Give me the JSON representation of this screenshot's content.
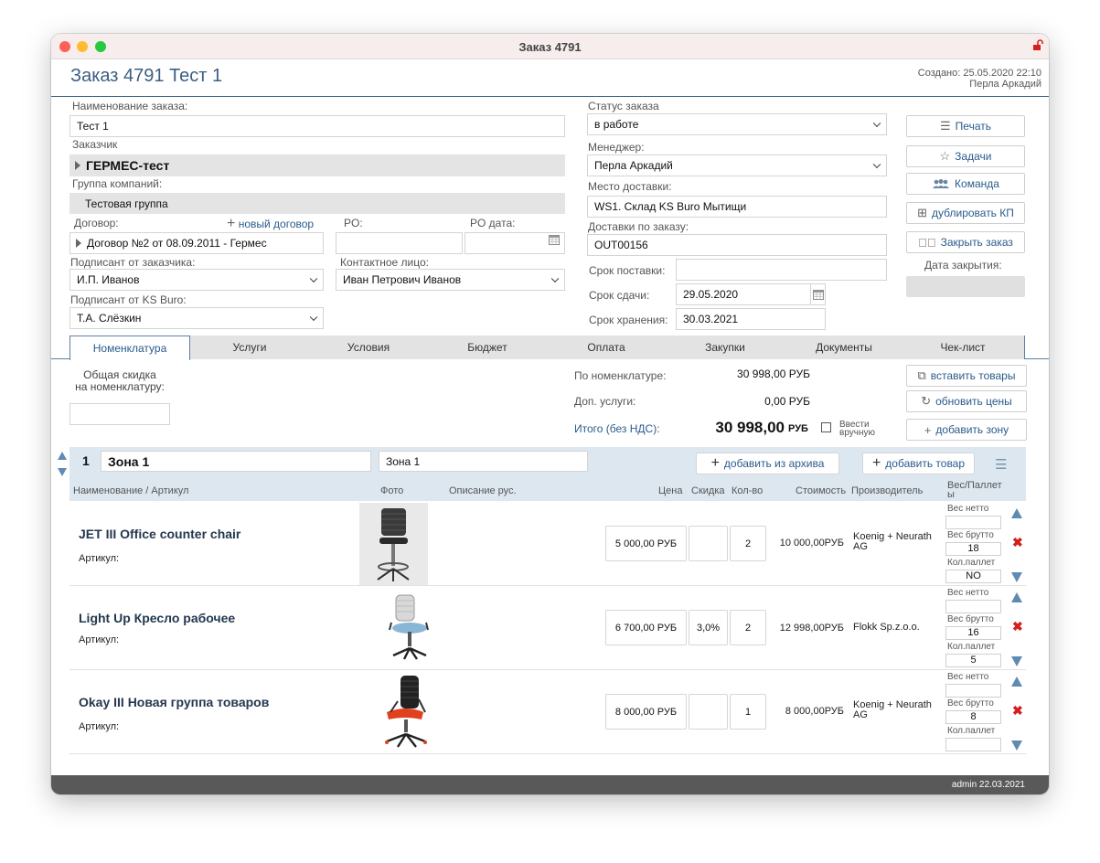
{
  "window": {
    "title": "Заказ 4791"
  },
  "header": {
    "title": "Заказ 4791 Тест 1",
    "created": "Создано: 25.05.2020 22:10",
    "author": "Перла Аркадий"
  },
  "form": {
    "order_name_label": "Наименование заказа:",
    "order_name_value": "Тест 1",
    "customer_label": "Заказчик",
    "customer_value": "ГЕРМЕС-тест",
    "group_label": "Группа компаний:",
    "group_value": "Тестовая группа",
    "contract_label": "Договор:",
    "new_contract_link": "новый договор",
    "contract_value": "Договор №2 от 08.09.2011 - Гермес",
    "po_label": "PO:",
    "po_value": "",
    "po_date_label": "PO дата:",
    "po_date_value": "",
    "signer_customer_label": "Подписант от заказчика:",
    "signer_customer_value": "И.П. Иванов",
    "contact_label": "Контактное лицо:",
    "contact_value": "Иван Петрович Иванов",
    "signer_ks_label": "Подписант от KS Buro:",
    "signer_ks_value": "Т.А. Слёзкин",
    "status_label": "Статус заказа",
    "status_value": "в работе",
    "manager_label": "Менеджер:",
    "manager_value": "Перла Аркадий",
    "delivery_place_label": "Место доставки:",
    "delivery_place_value": "WS1. Склад KS Buro Мытищи",
    "deliveries_label": "Доставки по заказу:",
    "deliveries_value": "OUT00156",
    "delivery_term_label": "Срок поставки:",
    "delivery_term_value": "",
    "handover_label": "Срок сдачи:",
    "handover_value": "29.05.2020",
    "storage_label": "Срок хранения:",
    "storage_value": "30.03.2021"
  },
  "actions": {
    "print": "Печать",
    "tasks": "Задачи",
    "team": "Команда",
    "duplicate": "дублировать КП",
    "close_order": "Закрыть заказ",
    "close_date_label": "Дата закрытия:"
  },
  "tabs": [
    "Номенклатура",
    "Услуги",
    "Условия",
    "Бюджет",
    "Оплата",
    "Закупки",
    "Документы",
    "Чек-лист"
  ],
  "summary": {
    "discount_label_1": "Общая скидка",
    "discount_label_2": "на номенклатуру:",
    "by_nomenclature_label": "По номенклатуре:",
    "by_nomenclature_value": "30 998,00 РУБ",
    "extra_services_label": "Доп. услуги:",
    "extra_services_value": "0,00 РУБ",
    "total_label": "Итого (без НДС):",
    "total_value": "30 998,00",
    "total_currency": "РУБ",
    "manual_label_1": "Ввести",
    "manual_label_2": "вручную",
    "insert_goods": "вставить товары",
    "update_prices": "обновить цены",
    "add_zone": "добавить зону"
  },
  "zone": {
    "number": "1",
    "name": "Зона 1",
    "name2": "Зона 1",
    "add_from_archive": "добавить из архива",
    "add_product": "добавить товар"
  },
  "columns": {
    "name": "Наименование / Артикул",
    "photo": "Фото",
    "desc": "Описание рус.",
    "price": "Цена",
    "discount": "Скидка",
    "qty": "Кол-во",
    "cost": "Стоимость",
    "maker": "Производитель",
    "weight_1": "Вес/Паллет",
    "weight_2": "ы"
  },
  "weight_labels": {
    "net": "Вес нетто",
    "gross": "Вес брутто",
    "pallets": "Кол.паллет"
  },
  "products": [
    {
      "name": "JET III  Office counter chair",
      "article": "Артикул:",
      "price": "5 000,00 РУБ",
      "discount": "",
      "qty": "2",
      "cost": "10 000,00РУБ",
      "maker_1": "Koenig + Neurath",
      "maker_2": "AG",
      "net": "",
      "gross": "18",
      "pallets": "NO"
    },
    {
      "name": "Light Up Кресло рабочее",
      "article": "Артикул:",
      "price": "6 700,00 РУБ",
      "discount": "3,0%",
      "qty": "2",
      "cost": "12 998,00РУБ",
      "maker_1": "Flokk Sp.z.o.o.",
      "maker_2": "",
      "net": "",
      "gross": "16",
      "pallets": "5"
    },
    {
      "name": "Okay III Новая группа товаров",
      "article": "Артикул:",
      "price": "8 000,00 РУБ",
      "discount": "",
      "qty": "1",
      "cost": "8 000,00РУБ",
      "maker_1": "Koenig + Neurath",
      "maker_2": "AG",
      "net": "",
      "gross": "8",
      "pallets": ""
    }
  ],
  "footer": {
    "text": "admin 22.03.2021"
  },
  "colors": {
    "accent": "#2a5b8c",
    "title": "#3b5f82",
    "zone_bg": "#dce7f0",
    "footer_bg": "#595959"
  }
}
